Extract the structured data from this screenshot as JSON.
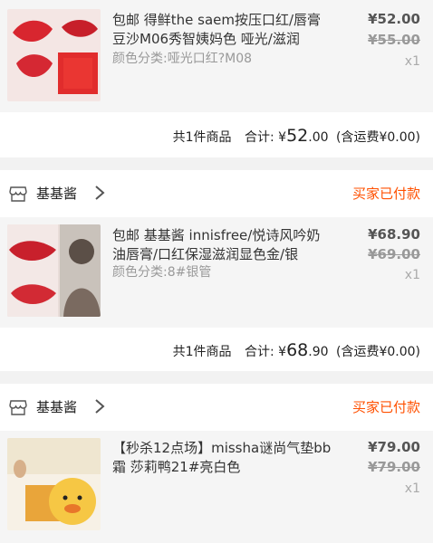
{
  "orders": [
    {
      "shop_name": "",
      "status": "",
      "product": {
        "title": "包邮 得鲜the saem按压口红/唇膏豆沙M06秀智姨妈色 哑光/滋润",
        "variant": "颜色分类:哑光口红?M08",
        "price": "¥52.00",
        "original_price": "¥55.00",
        "qty": "x1"
      },
      "summary": {
        "count": "共1件商品",
        "label": "合计:",
        "amount_prefix": "¥",
        "amount_int": "52",
        "amount_dec": ".00",
        "shipping": "(含运费¥0.00)"
      }
    },
    {
      "shop_name": "基基酱",
      "status": "买家已付款",
      "product": {
        "title": "包邮 基基酱 innisfree/悦诗风吟奶油唇膏/口红保湿滋润显色金/银",
        "variant": "颜色分类:8#银管",
        "price": "¥68.90",
        "original_price": "¥69.00",
        "qty": "x1"
      },
      "summary": {
        "count": "共1件商品",
        "label": "合计:",
        "amount_prefix": "¥",
        "amount_int": "68",
        "amount_dec": ".90",
        "shipping": "(含运费¥0.00)"
      }
    },
    {
      "shop_name": "基基酱",
      "status": "买家已付款",
      "product": {
        "title": "【秒杀12点场】missha谜尚气垫bb霜 莎莉鸭21#亮白色",
        "variant": "",
        "price": "¥79.00",
        "original_price": "¥79.00",
        "qty": "x1"
      }
    }
  ],
  "icons": {
    "shop": "shop-icon",
    "chevron": "chevron-right-icon"
  },
  "colors": {
    "accent": "#ff5000",
    "muted": "#999999"
  }
}
